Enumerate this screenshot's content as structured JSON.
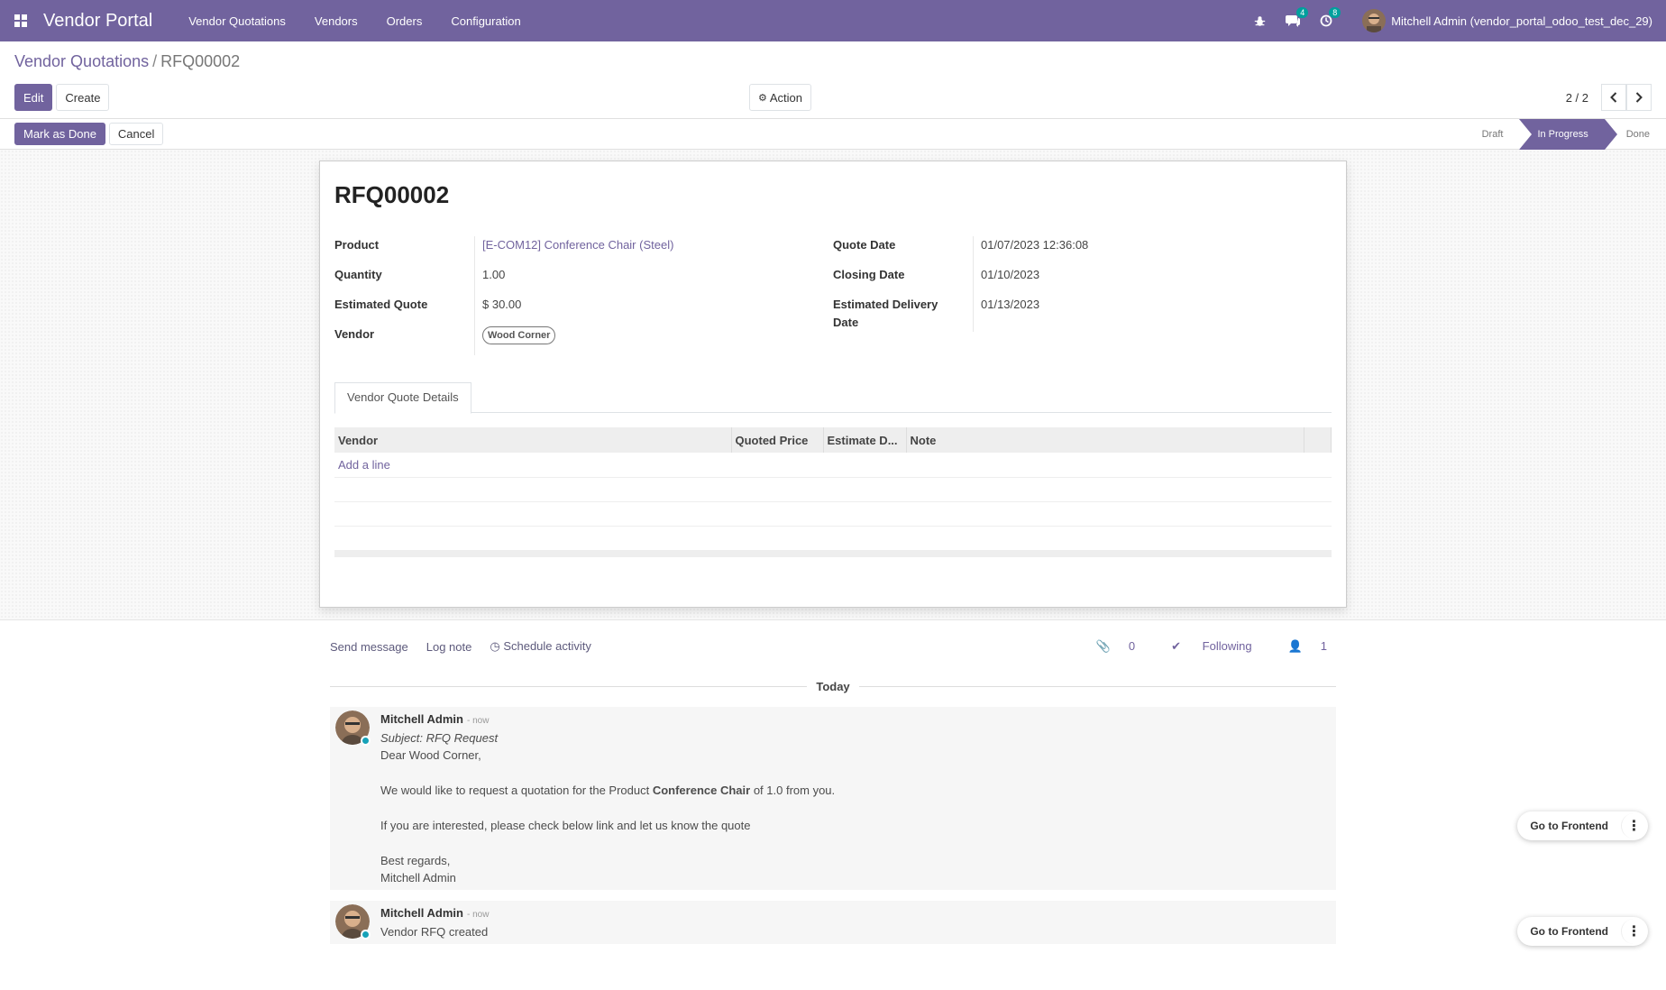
{
  "topbar": {
    "brand": "Vendor Portal",
    "nav": [
      "Vendor Quotations",
      "Vendors",
      "Orders",
      "Configuration"
    ],
    "messages_badge": "4",
    "activities_badge": "8",
    "user": "Mitchell Admin (vendor_portal_odoo_test_dec_29)"
  },
  "breadcrumb": {
    "parent": "Vendor Quotations",
    "separator": "/",
    "current": "RFQ00002"
  },
  "control": {
    "edit": "Edit",
    "create": "Create",
    "action": "Action",
    "pager": "2 / 2"
  },
  "statusbar": {
    "mark_done": "Mark as Done",
    "cancel": "Cancel",
    "steps": [
      "Draft",
      "In Progress",
      "Done"
    ]
  },
  "record": {
    "name": "RFQ00002",
    "left": [
      {
        "label": "Product",
        "value": "[E-COM12] Conference Chair (Steel)"
      },
      {
        "label": "Quantity",
        "value": "1.00"
      },
      {
        "label": "Estimated Quote",
        "value": "$ 30.00"
      },
      {
        "label": "Vendor",
        "value": "Wood Corner"
      }
    ],
    "right": [
      {
        "label": "Quote Date",
        "value": "01/07/2023 12:36:08"
      },
      {
        "label": "Closing Date",
        "value": "01/10/2023"
      },
      {
        "label": "Estimated Delivery Date",
        "value": "01/13/2023"
      }
    ]
  },
  "tab": {
    "label": "Vendor Quote Details"
  },
  "table": {
    "columns": [
      "Vendor",
      "Quoted Price",
      "Estimate D...",
      "Note"
    ],
    "add_line": "Add a line"
  },
  "chatter": {
    "send_message": "Send message",
    "log_note": "Log note",
    "schedule_activity": "Schedule activity",
    "attachments": "0",
    "following": "Following",
    "followers": "1",
    "day": "Today",
    "messages": [
      {
        "author": "Mitchell Admin",
        "time": "- now",
        "subject": "Subject: RFQ Request",
        "greeting": "Dear Wood Corner,",
        "line1_pre": "We would like to request a quotation for the Product ",
        "line1_bold": "Conference Chair",
        "line1_post": " of 1.0 from you.",
        "line2": "If you are interested, please check below link and let us know the quote",
        "regards": "Best regards,",
        "signature": "Mitchell Admin"
      },
      {
        "author": "Mitchell Admin",
        "time": "- now",
        "text": "Vendor RFQ created"
      }
    ],
    "go_frontend": "Go to Frontend"
  },
  "colors": {
    "primary": "#71639e",
    "badge": "#00a09d",
    "following": "#28a745"
  }
}
